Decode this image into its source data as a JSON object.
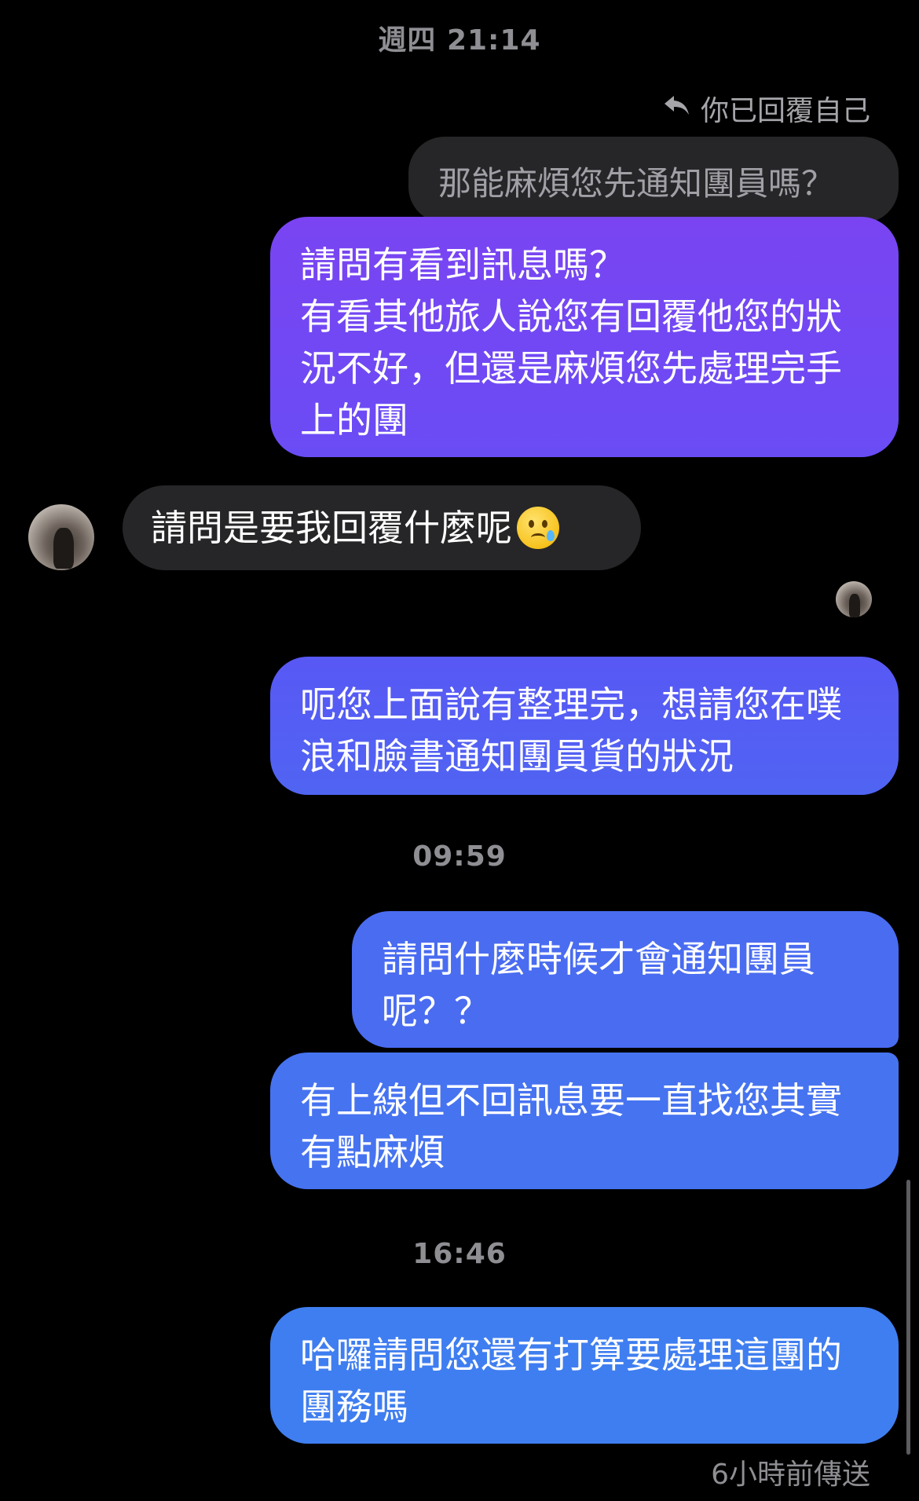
{
  "timestamps": {
    "t1": "週四 21:14",
    "t2": "09:59",
    "t3": "16:46"
  },
  "reply": {
    "note": "你已回覆自己",
    "quoted_text": "那能麻煩您先通知團員嗎？"
  },
  "messages": {
    "m1": "請問有看到訊息嗎？\n有看其他旅人說您有回覆他您的狀況不好，但還是麻煩您先處理完手上的團",
    "incoming": "請問是要我回覆什麼呢",
    "incoming_emoji": "crying-smile-emoji",
    "m2": "呃您上面說有整理完，想請您在噗浪和臉書通知團員貨的狀況",
    "m3": "請問什麼時候才會通知團員呢？？",
    "m4": "有上線但不回訊息要一直找您其實有點麻煩",
    "m5": "哈囉請問您還有打算要處理這團的團務嗎"
  },
  "status": {
    "sent": "6小時前傳送"
  },
  "colors": {
    "bg": "#000000",
    "incoming_bubble": "#262628",
    "bubble_purple": "#7a44f2",
    "bubble_blue": "#3f7ef0"
  }
}
